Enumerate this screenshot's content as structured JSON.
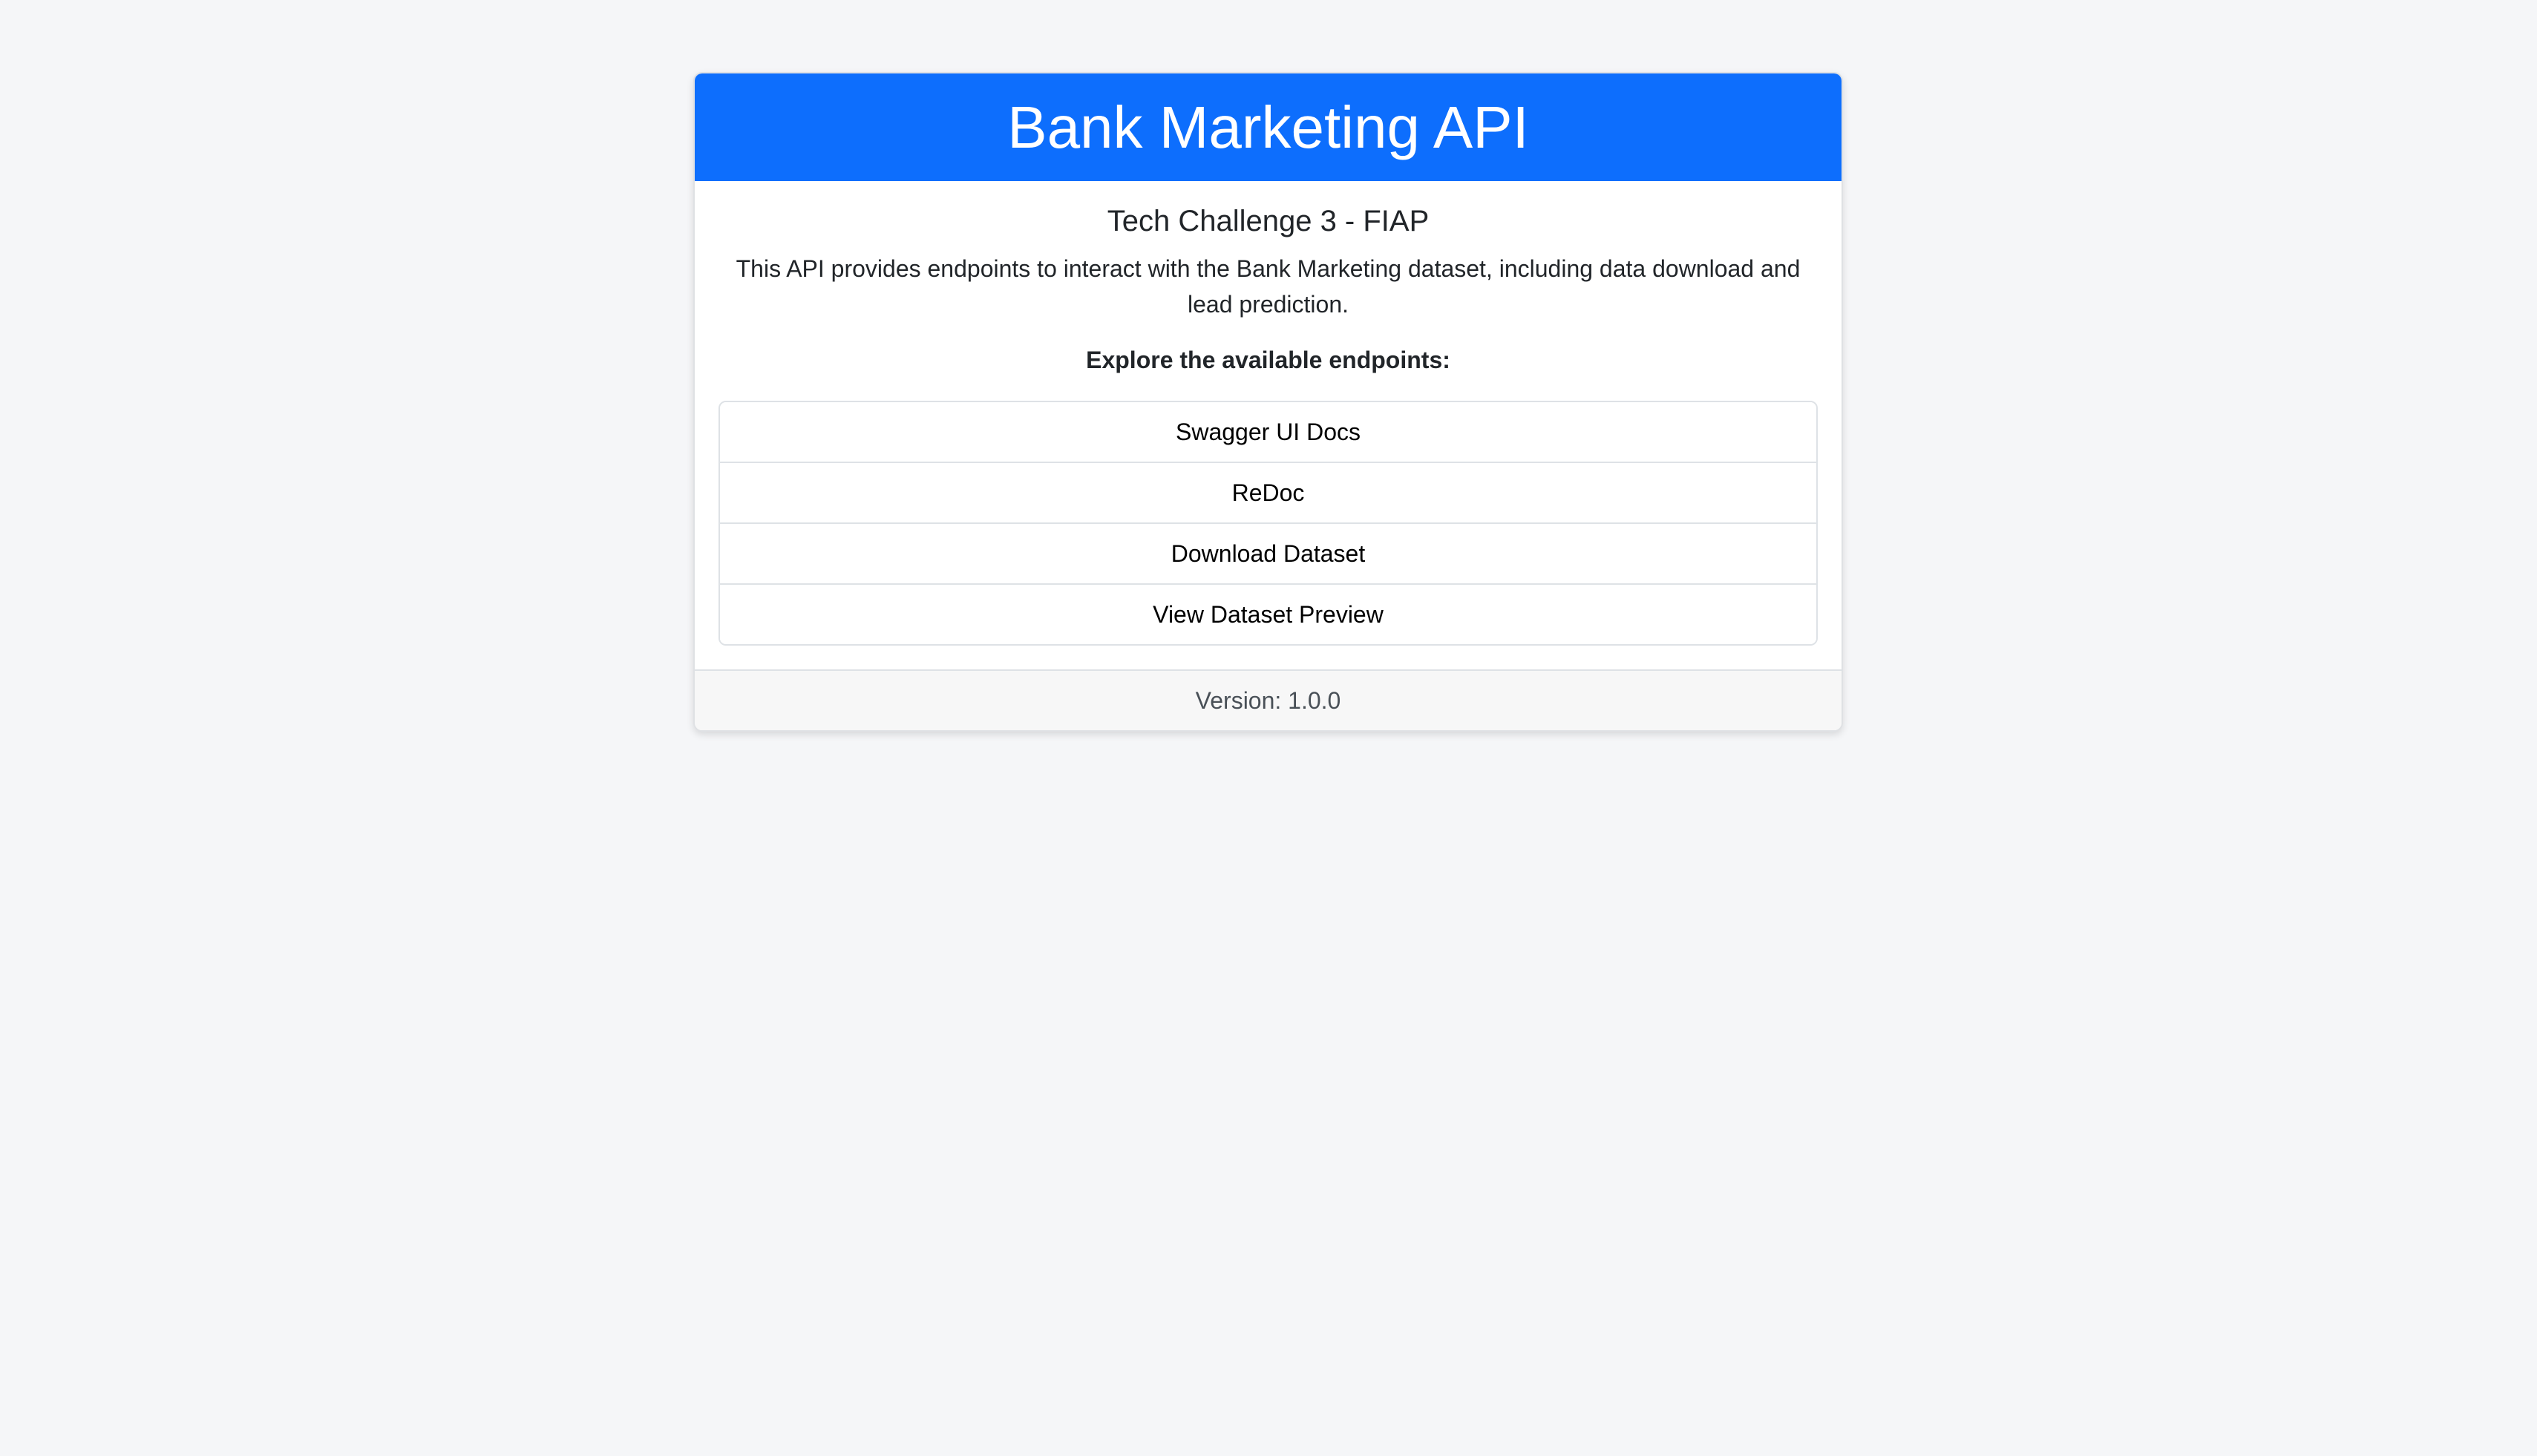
{
  "header": {
    "title": "Bank Marketing API"
  },
  "body": {
    "subtitle": "Tech Challenge 3 - FIAP",
    "description": "This API provides endpoints to interact with the Bank Marketing dataset, including data download and lead prediction.",
    "explore_heading": "Explore the available endpoints:",
    "endpoints": [
      {
        "label": "Swagger UI Docs"
      },
      {
        "label": "ReDoc"
      },
      {
        "label": "Download Dataset"
      },
      {
        "label": "View Dataset Preview"
      }
    ]
  },
  "footer": {
    "version_text": "Version: 1.0.0"
  },
  "colors": {
    "accent": "#0d6efd",
    "page_background": "#f5f6f8"
  }
}
